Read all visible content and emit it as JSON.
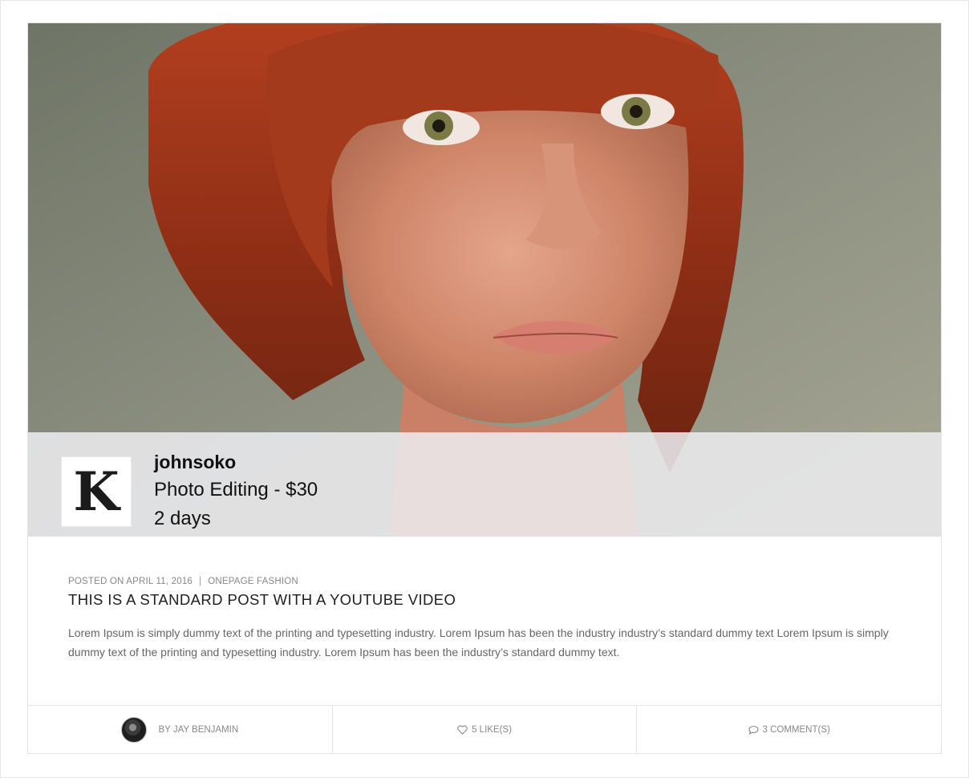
{
  "hero": {
    "image": "portrait-photo",
    "banner": {
      "logo_letter": "K",
      "seller": "johnsoko",
      "service": "Photo Editing - $30",
      "duration": "2 days"
    }
  },
  "post": {
    "posted_on": "POSTED ON APRIL 11, 2016",
    "separator": "|",
    "category": "ONEPAGE FASHION",
    "title": "THIS IS A STANDARD POST WITH A YOUTUBE VIDEO",
    "excerpt": "Lorem Ipsum is simply dummy text of the printing and typesetting industry. Lorem Ipsum has been the industry industry’s standard dummy text Lorem Ipsum is simply dummy text of the printing and typesetting industry. Lorem Ipsum has been the industry’s standard dummy text."
  },
  "footer": {
    "author": "BY JAY BENJAMIN",
    "likes": "5 LIKE(S)",
    "comments": "3 COMMENT(S)",
    "icons": {
      "likes": "heart-icon",
      "comments": "comment-icon"
    }
  },
  "colors": {
    "text_muted": "#888888",
    "title": "#1e1e1e",
    "border": "#e5e5e5"
  }
}
